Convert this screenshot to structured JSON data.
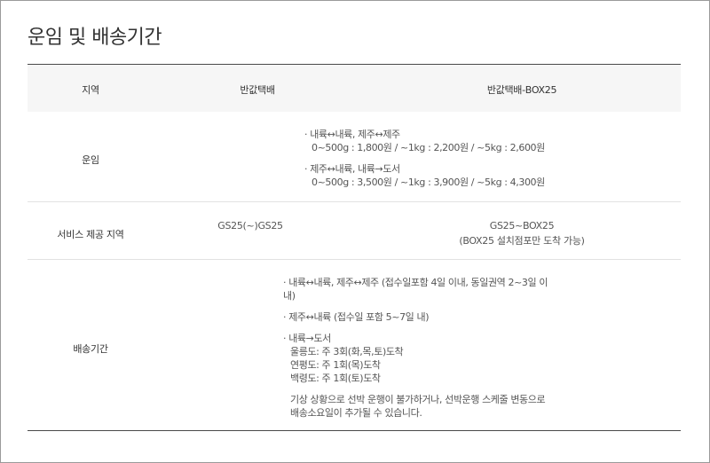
{
  "page": {
    "title": "운임 및 배송기간"
  },
  "table": {
    "headers": {
      "region": "지역",
      "col_a": "반값택배",
      "col_b": "반값택배-BOX25"
    },
    "rows": {
      "fare": {
        "label": "운임",
        "lines": [
          "· 내륙↔내륙, 제주↔제주",
          "  0~500g : 1,800원 / ~1kg : 2,200원 / ~5kg : 2,600원",
          "· 제주↔내륙, 내륙→도서",
          "  0~500g : 3,500원 / ~1kg : 3,900원 / ~5kg : 4,300원"
        ]
      },
      "service_area": {
        "label": "서비스 제공 지역",
        "col_a": "GS25(~)GS25",
        "col_b_line1": "GS25~BOX25",
        "col_b_line2": "(BOX25 설치점포만 도착 가능)"
      },
      "delivery_period": {
        "label": "배송기간",
        "lines": [
          "· 내륙↔내륙, 제주↔제주 (접수일포함 4일 이내, 동일권역 2~3일 이",
          "내)",
          "· 제주↔내륙 (접수일 포함 5~7일 내)",
          "· 내륙→도서",
          "  울릉도: 주 3회(화,목,토)도착",
          "  연평도: 주 1회(목)도착",
          "  백령도: 주 1회(토)도착",
          "  기상 상황으로 선박 운행이 불가하거나, 선박운행 스케줄 변동으로",
          "  배송소요일이 추가될 수 있습니다."
        ]
      }
    }
  }
}
